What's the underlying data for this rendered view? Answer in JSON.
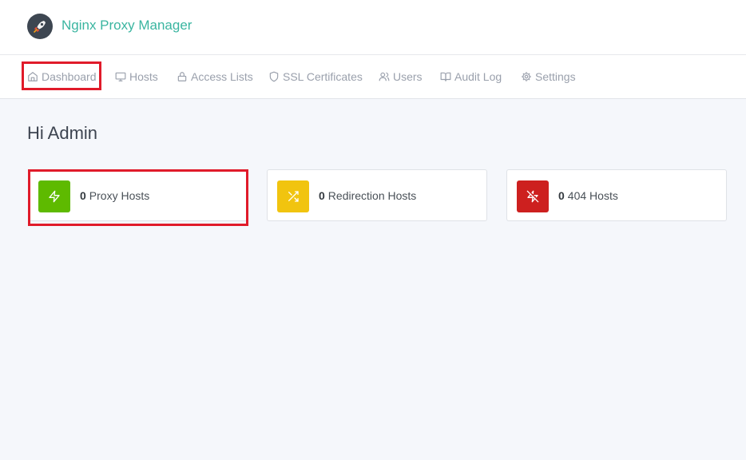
{
  "app": {
    "title": "Nginx Proxy Manager"
  },
  "nav": {
    "items": [
      {
        "label": "Dashboard",
        "icon": "home-icon"
      },
      {
        "label": "Hosts",
        "icon": "monitor-icon"
      },
      {
        "label": "Access Lists",
        "icon": "lock-icon"
      },
      {
        "label": "SSL Certificates",
        "icon": "shield-icon"
      },
      {
        "label": "Users",
        "icon": "users-icon"
      },
      {
        "label": "Audit Log",
        "icon": "book-icon"
      },
      {
        "label": "Settings",
        "icon": "gear-icon"
      }
    ]
  },
  "main": {
    "greeting": "Hi Admin",
    "cards": [
      {
        "count": "0",
        "label": "Proxy Hosts",
        "icon": "zap-icon",
        "color": "#5eba00"
      },
      {
        "count": "0",
        "label": "Redirection Hosts",
        "icon": "shuffle-icon",
        "color": "#f1c40f"
      },
      {
        "count": "0",
        "label": "404 Hosts",
        "icon": "zap-off-icon",
        "color": "#cd201f"
      }
    ]
  },
  "colors": {
    "accent": "#3ab5a0",
    "highlight": "#e01b2a",
    "background": "#f5f7fb"
  }
}
